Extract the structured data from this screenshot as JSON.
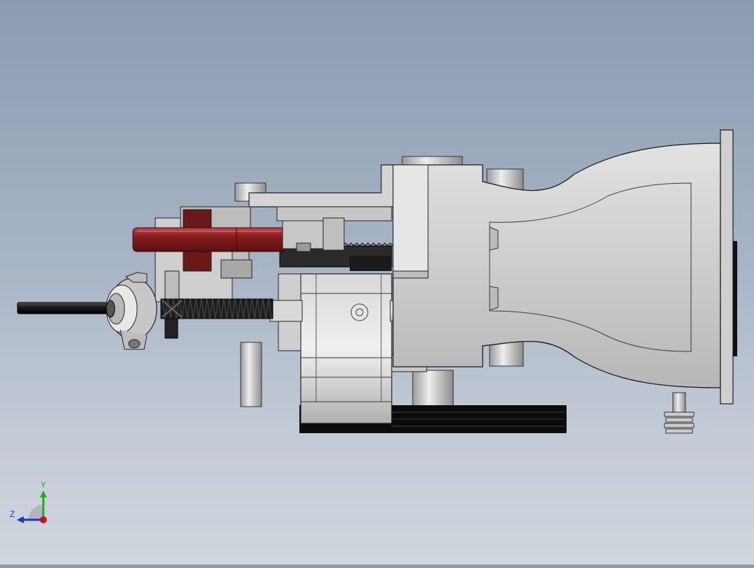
{
  "viewport": {
    "background_top": "#8b9bb1",
    "background_bottom": "#d0d6de"
  },
  "model": {
    "part_colors": {
      "housing": "#cfcfcf",
      "housing_dark": "#a9a9a9",
      "edge": "#1a1a1a",
      "handle": "#8a1e1e",
      "handle_highlight": "#b33a3a",
      "shaft": "#1c1c1c",
      "belt": "#0a0a0a"
    }
  },
  "triad": {
    "axis_y_label": "Y",
    "axis_z_label": "Z",
    "axis_y_color": "#22aa22",
    "axis_z_color": "#2233cc",
    "origin_color": "#cc1111"
  }
}
